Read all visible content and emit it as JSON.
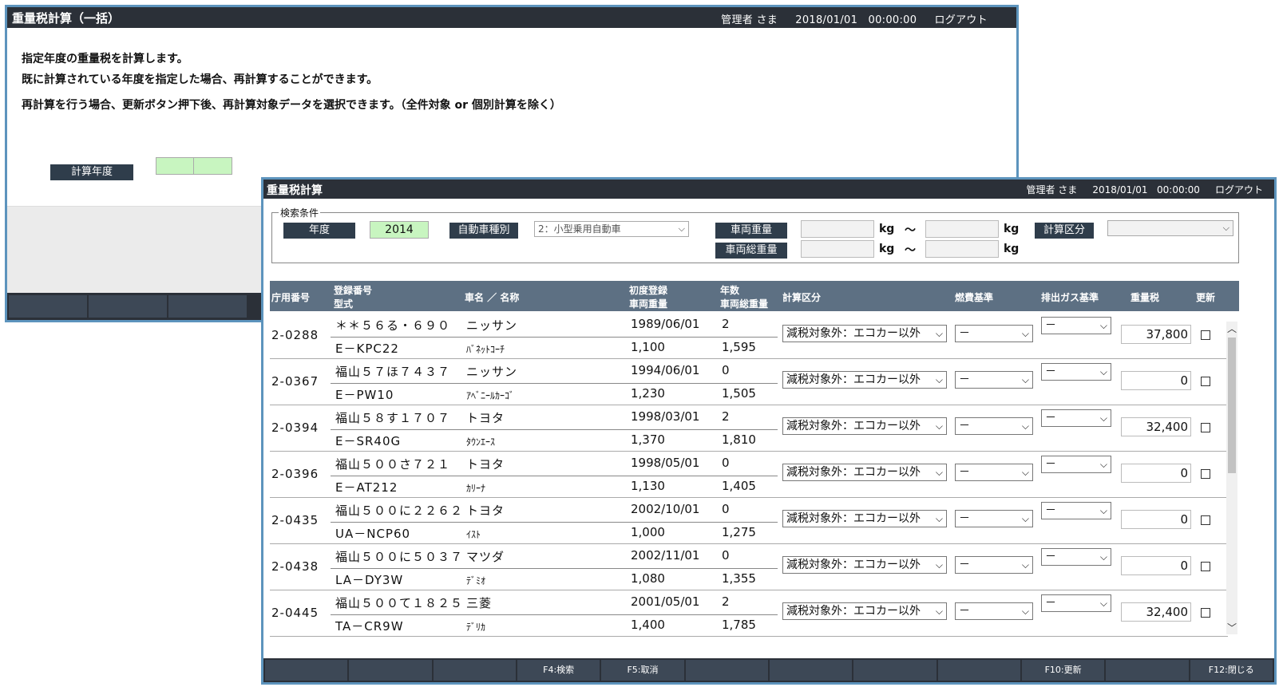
{
  "back_window": {
    "title": "重量税計算（一括）",
    "user": "管理者 さま",
    "date": "2018/01/01",
    "time": "00:00:00",
    "logout": "ログアウト",
    "messages": [
      "指定年度の重量税を計算します。",
      "既に計算されている年度を指定した場合、再計算することができます。",
      "再計算を行う場合、更新ボタン押下後、再計算対象データを選択できます。（全件対象 or 個別計算を除く）"
    ],
    "year_label": "計算年度"
  },
  "front_window": {
    "title": "重量税計算",
    "user": "管理者 さま",
    "date": "2018/01/01",
    "time": "00:00:00",
    "logout": "ログアウト",
    "search": {
      "legend": "検索条件",
      "year_label": "年度",
      "year_value": "2014",
      "car_type_label": "自動車種別",
      "car_type_value": "2：小型乗用自動車",
      "weight_label": "車両重量",
      "gross_weight_label": "車両総重量",
      "unit": "kg",
      "tilde": "～",
      "calc_class_label": "計算区分"
    },
    "headers": {
      "office_no": "庁用番号",
      "reg_no": "登録番号",
      "model": "型式",
      "car_name": "車名 ／ 名称",
      "first_reg": "初度登録",
      "vehicle_weight": "車両重量",
      "years": "年数",
      "gross_weight": "車両総重量",
      "calc_class": "計算区分",
      "fuel_std": "燃費基準",
      "gas_std": "排出ガス基準",
      "tax": "重量税",
      "update": "更新"
    },
    "rows": [
      {
        "office": "2-0288",
        "reg": "＊＊５６る・６９０",
        "model": "E－KPC22",
        "maker": "ニッサン",
        "name": "ﾊﾞﾈｯﾄｺｰﾁ",
        "first": "1989/06/01",
        "weight": "1,100",
        "years": "2",
        "gross": "1,595",
        "calc": "減税対象外：エコカー以外",
        "fuel": "－",
        "gas": "－",
        "tax": "37,800"
      },
      {
        "office": "2-0367",
        "reg": "福山５７ほ７４３７",
        "model": "E－PW10",
        "maker": "ニッサン",
        "name": "ｱﾍﾞﾆｰﾙｶｰｺﾞ",
        "first": "1994/06/01",
        "weight": "1,230",
        "years": "0",
        "gross": "1,505",
        "calc": "減税対象外：エコカー以外",
        "fuel": "－",
        "gas": "－",
        "tax": "0"
      },
      {
        "office": "2-0394",
        "reg": "福山５８す１７０７",
        "model": "E－SR40G",
        "maker": "トヨタ",
        "name": "ﾀｳﾝｴｰｽ",
        "first": "1998/03/01",
        "weight": "1,370",
        "years": "2",
        "gross": "1,810",
        "calc": "減税対象外：エコカー以外",
        "fuel": "－",
        "gas": "－",
        "tax": "32,400"
      },
      {
        "office": "2-0396",
        "reg": "福山５００さ７２１",
        "model": "E－AT212",
        "maker": "トヨタ",
        "name": "ｶﾘｰﾅ",
        "first": "1998/05/01",
        "weight": "1,130",
        "years": "0",
        "gross": "1,405",
        "calc": "減税対象外：エコカー以外",
        "fuel": "－",
        "gas": "－",
        "tax": "0"
      },
      {
        "office": "2-0435",
        "reg": "福山５００に２２６２",
        "model": "UA－NCP60",
        "maker": "トヨタ",
        "name": "ｲｽﾄ",
        "first": "2002/10/01",
        "weight": "1,000",
        "years": "0",
        "gross": "1,275",
        "calc": "減税対象外：エコカー以外",
        "fuel": "－",
        "gas": "－",
        "tax": "0"
      },
      {
        "office": "2-0438",
        "reg": "福山５００に５０３７",
        "model": "LA－DY3W",
        "maker": "マツダ",
        "name": "ﾃﾞﾐｵ",
        "first": "2002/11/01",
        "weight": "1,080",
        "years": "0",
        "gross": "1,355",
        "calc": "減税対象外：エコカー以外",
        "fuel": "－",
        "gas": "－",
        "tax": "0"
      },
      {
        "office": "2-0445",
        "reg": "福山５００て１８２５",
        "model": "TA－CR9W",
        "maker": "三菱",
        "name": "ﾃﾞﾘｶ",
        "first": "2001/05/01",
        "weight": "1,400",
        "years": "2",
        "gross": "1,785",
        "calc": "減税対象外：エコカー以外",
        "fuel": "－",
        "gas": "－",
        "tax": "32,400"
      }
    ],
    "fkeys": [
      "",
      "",
      "",
      "F4:検索",
      "F5:取消",
      "",
      "",
      "",
      "",
      "F10:更新",
      "",
      "F12:閉じる"
    ]
  }
}
